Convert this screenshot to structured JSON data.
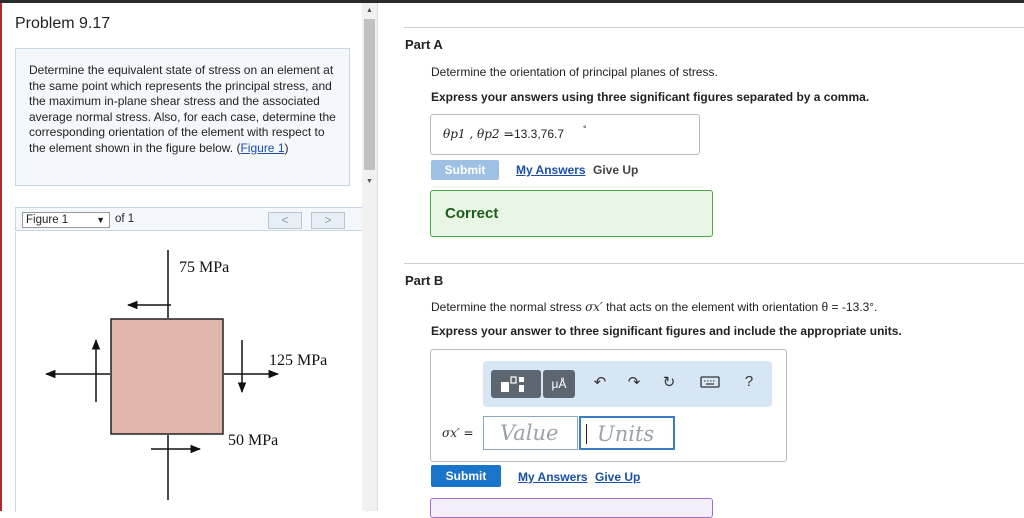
{
  "problem": {
    "title": "Problem 9.17",
    "text": "Determine the equivalent state of stress on an element at the same point which represents the principal stress, and the maximum in-plane shear stress and the associated average normal stress. Also, for each case, determine the corresponding orientation of the element with respect to the element shown in the figure below. ",
    "figure_link_open": "(",
    "figure_link": "Figure 1",
    "figure_link_close": ")"
  },
  "figure_nav": {
    "selected": "Figure 1",
    "of_text": "of 1",
    "prev": "<",
    "next": ">"
  },
  "figure": {
    "label_top": "75 MPa",
    "label_right": "125 MPa",
    "label_bottom": "50 MPa",
    "element_color": "#e1b6ab"
  },
  "partA": {
    "title": "Part A",
    "instruction": "Determine the orientation of principal planes of stress.",
    "format": "Express your answers using three significant figures separated by a comma.",
    "answer_label": "θp1 , θp2 =",
    "answer_value": "-13.3,76.7",
    "answer_unit": "°",
    "submit_label": "Submit",
    "my_answers": "My Answers",
    "give_up": "Give Up",
    "result": "Correct"
  },
  "partB": {
    "title": "Part B",
    "instruction_pre": "Determine the normal stress ",
    "instruction_sym": "σx′",
    "instruction_post": " that acts on the element with orientation θ = -13.3°.",
    "format": "Express your answer to three significant figures and include the appropriate units.",
    "toolbar": {
      "templates_icon": "templates-icon",
      "units_label": "μÅ",
      "help_label": "?"
    },
    "answer_label": "σx′ =",
    "value_placeholder": "Value",
    "units_placeholder": "Units",
    "submit_label": "Submit",
    "my_answers": "My Answers",
    "give_up": "Give Up"
  },
  "colors": {
    "accent": "#1a74c9",
    "correct_border": "#4caa46",
    "link": "#1a4fa5"
  }
}
